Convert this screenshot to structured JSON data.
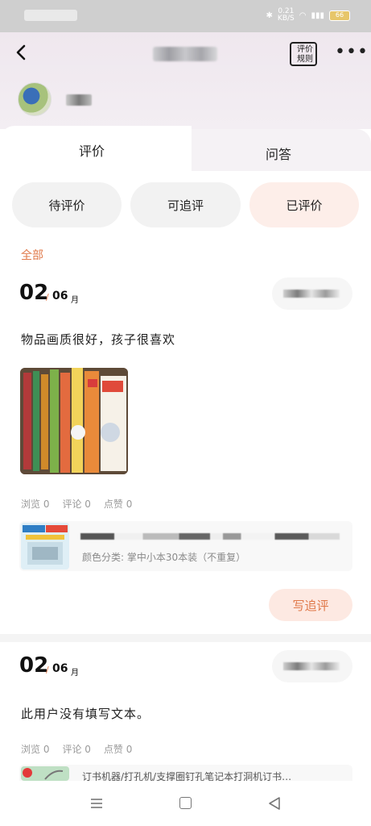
{
  "status_bar": {
    "speed": "0.21\nKB/S",
    "battery": "66"
  },
  "header": {
    "rules_label": "评价\n规则"
  },
  "tabs": [
    {
      "label": "评价",
      "active": true
    },
    {
      "label": "问答",
      "active": false
    }
  ],
  "filter_chips": [
    {
      "label": "待评价",
      "active": false
    },
    {
      "label": "可追评",
      "active": false
    },
    {
      "label": "已评价",
      "active": true
    }
  ],
  "filter_label": "全部",
  "reviews": [
    {
      "date_day": "02",
      "date_slash": "/",
      "date_month": "06",
      "date_unit": "月",
      "text": "物品画质很好，孩子很喜欢",
      "stats": [
        "浏览 0",
        "评论 0",
        "点赞 0"
      ],
      "product_sku": "颜色分类: 掌中小本30本装（不重复）",
      "followup_label": "写追评"
    },
    {
      "date_day": "02",
      "date_slash": "/",
      "date_month": "06",
      "date_unit": "月",
      "text": "此用户没有填写文本。",
      "stats": [
        "浏览 0",
        "评论 0",
        "点赞 0"
      ],
      "product_name": "订书机器/打孔机/支撑圈钉孔笔记本打洞机订书…"
    }
  ],
  "colors": {
    "accent": "#e0794a",
    "chip_active_bg": "#fdeee9",
    "chip_bg": "#f2f2f2",
    "header_bg": "#efe7ee"
  }
}
